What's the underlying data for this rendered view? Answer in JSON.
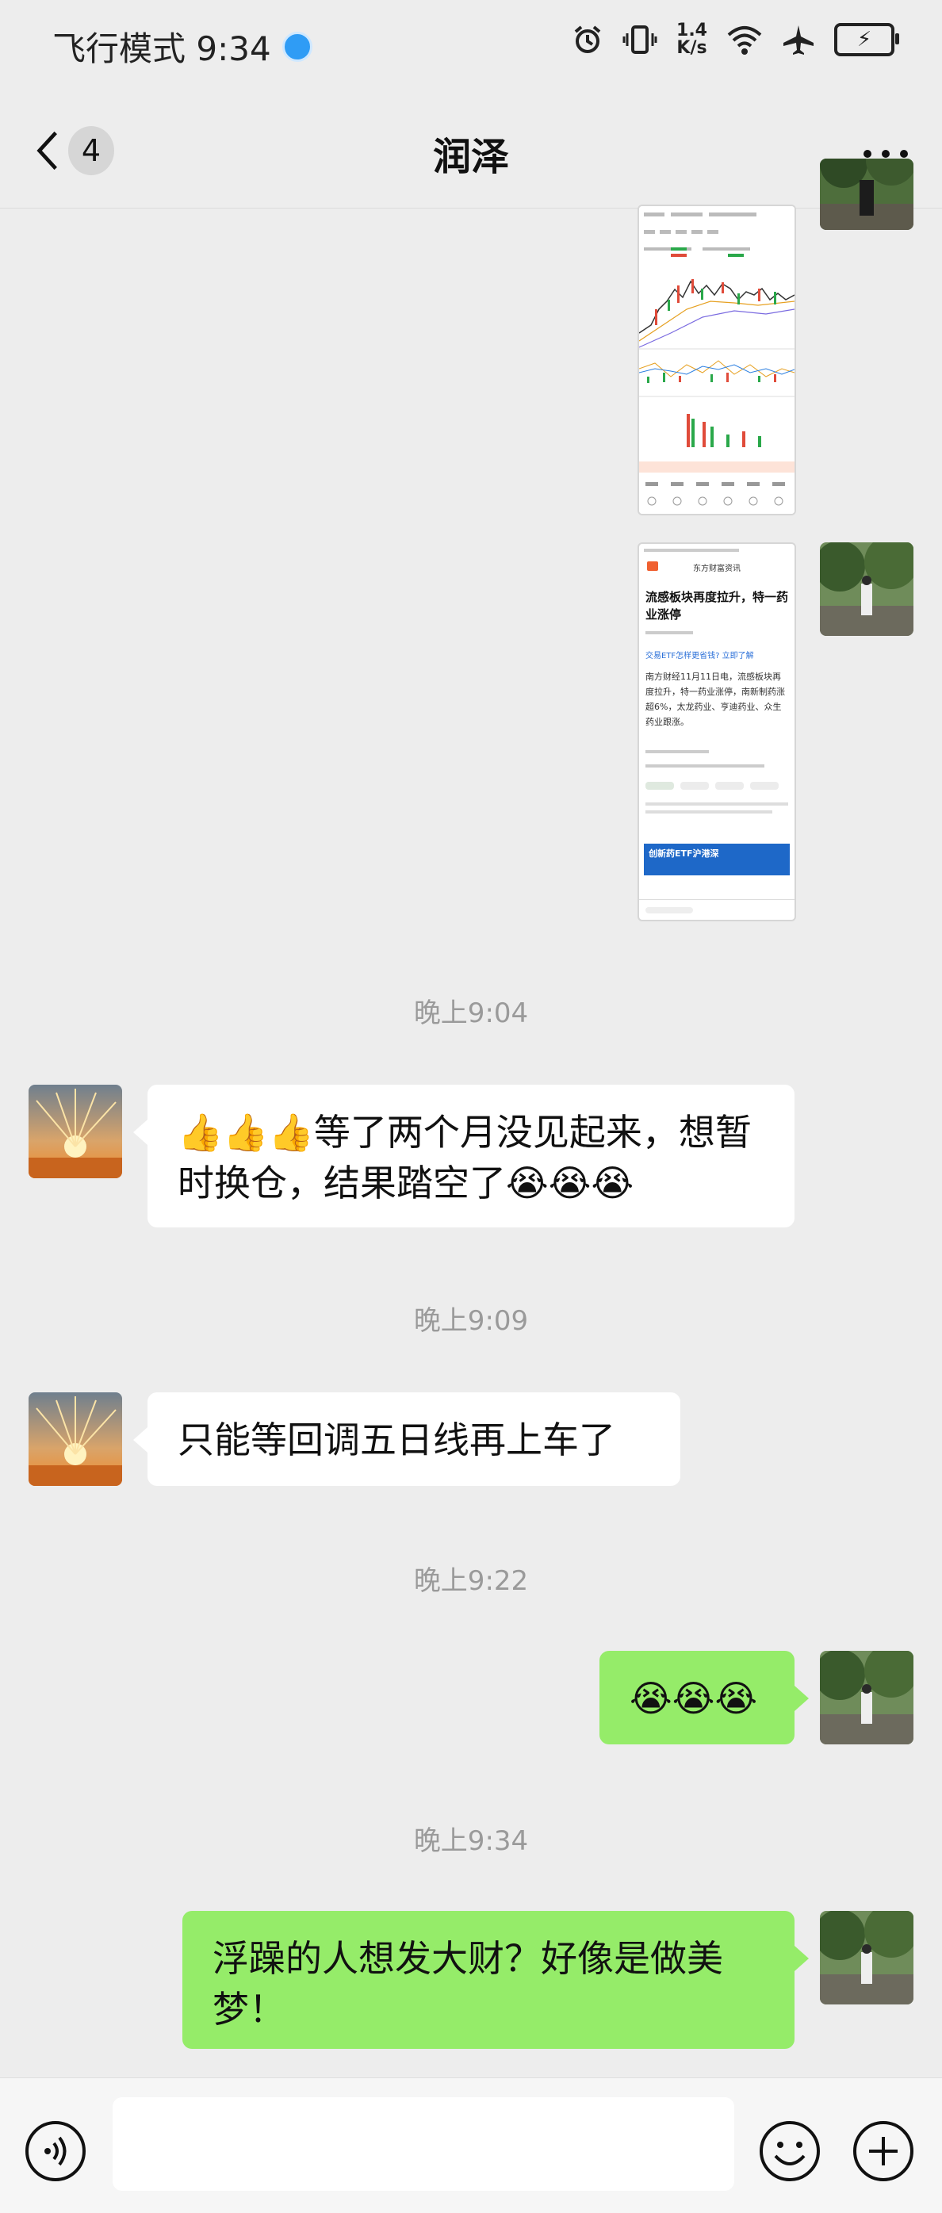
{
  "status_bar": {
    "left_text": "飞行模式 9:34",
    "speed_value": "1.4",
    "speed_unit": "K/s"
  },
  "header": {
    "back_badge": "4",
    "title": "润泽"
  },
  "news_card": {
    "source": "东方财富资讯",
    "headline": "流感板块再度拉升，特一药业涨停",
    "promo": "交易ETF怎样更省钱? 立即了解",
    "body": "南方财经11月11日电，流感板块再度拉升，特一药业涨停，南新制药涨超6%，太龙药业、亨迪药业、众生药业跟涨。",
    "banner": "创新药ETF沪港深"
  },
  "messages": [
    {
      "time": "晚上9:04"
    },
    {
      "text": "👍👍👍等了两个月没见起来，想暂时换仓，结果踏空了😭😭😭"
    },
    {
      "time": "晚上9:09"
    },
    {
      "text": "只能等回调五日线再上车了"
    },
    {
      "time": "晚上9:22"
    },
    {
      "text": "😭😭😭"
    },
    {
      "time": "晚上9:34"
    },
    {
      "text": "浮躁的人想发大财？好像是做美梦！"
    }
  ],
  "input": {
    "value": ""
  }
}
